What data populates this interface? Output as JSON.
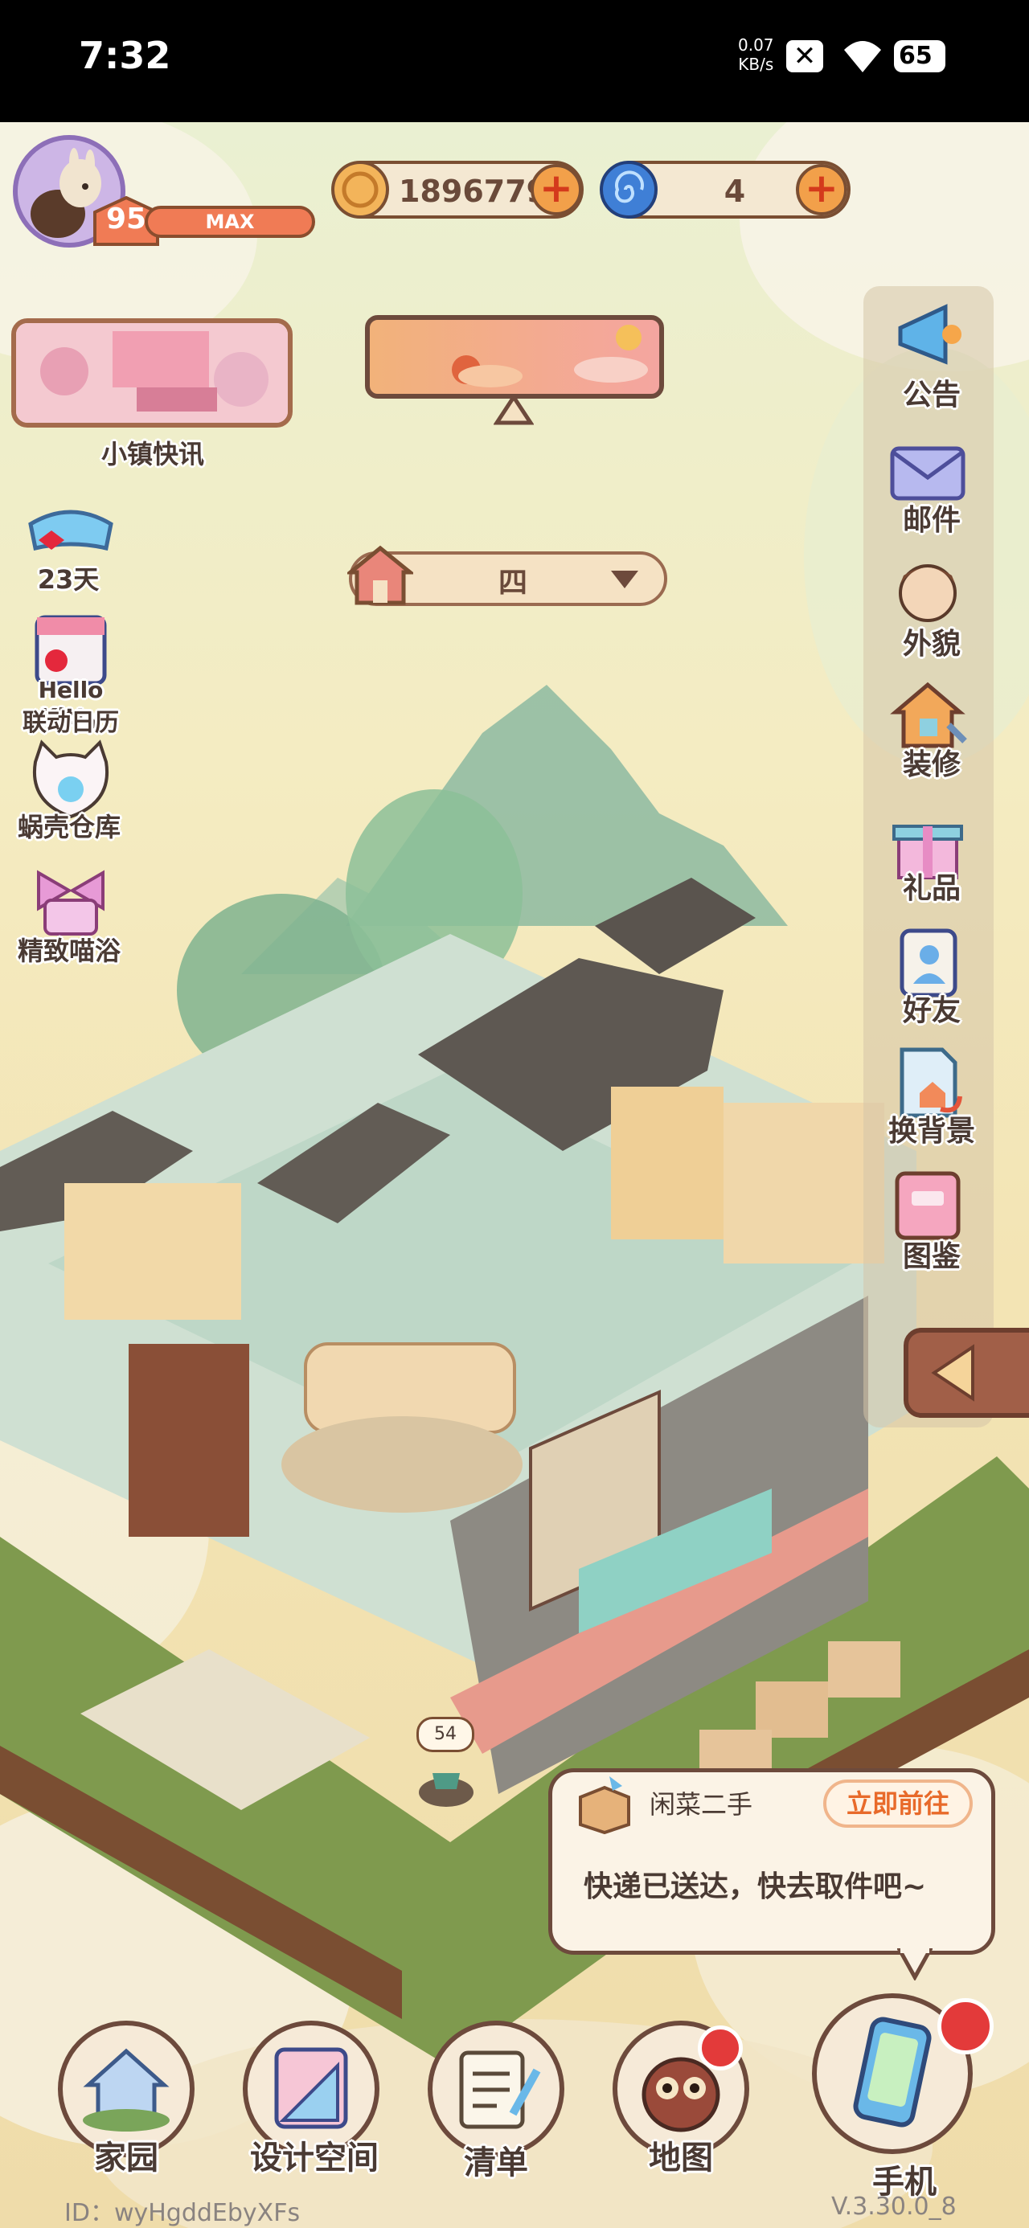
{
  "status_bar": {
    "time": "7:32",
    "net_speed_value": "0.07",
    "net_speed_unit": "KB/s",
    "battery": "65"
  },
  "player": {
    "level": "95",
    "level_status": "MAX"
  },
  "currencies": {
    "coins": "1896779",
    "shells": "4",
    "plus": "+"
  },
  "news": {
    "label": "小镇快讯"
  },
  "floor": {
    "value": "四"
  },
  "left_menu": [
    {
      "label": "23天"
    },
    {
      "label": "Hello Kitty"
    },
    {
      "label": "联动日历"
    },
    {
      "label": "蜗壳仓库"
    },
    {
      "label": "精致喵浴"
    }
  ],
  "right_menu": [
    {
      "label": "公告"
    },
    {
      "label": "邮件"
    },
    {
      "label": "外貌"
    },
    {
      "label": "装修"
    },
    {
      "label": "礼品"
    },
    {
      "label": "好友"
    },
    {
      "label": "换背景"
    },
    {
      "label": "图鉴"
    }
  ],
  "notification": {
    "app": "闲菜二手",
    "action": "立即前往",
    "message": "快递已送达，快去取件吧~"
  },
  "mailbox_count": "54",
  "bottom_nav": [
    {
      "label": "家园"
    },
    {
      "label": "设计空间"
    },
    {
      "label": "清单"
    },
    {
      "label": "地图"
    },
    {
      "label": "手机"
    }
  ],
  "footer": {
    "id": "ID：wyHgddEbyXFs",
    "version": "V.3.30.0_8"
  },
  "colors": {
    "brand_orange": "#f07b55",
    "panel_brown": "#6d4a3c",
    "alert_red": "#e33a3a"
  }
}
